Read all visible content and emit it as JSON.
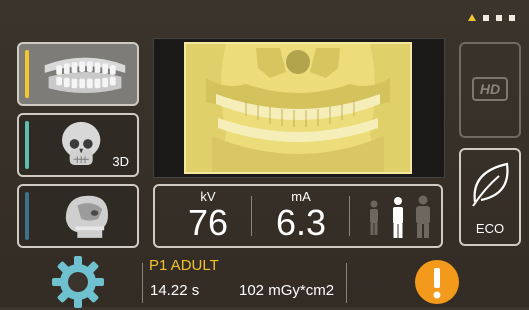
{
  "header": {
    "page_indicator": {
      "count": 4,
      "active_index": 0,
      "active_color": "#f2c532"
    }
  },
  "modes": [
    {
      "name": "panoramic",
      "selected": true,
      "accent": "#f2c532",
      "icon": "panoramic-teeth-icon"
    },
    {
      "name": "3d",
      "label": "3D",
      "selected": false,
      "accent": "#5bbfb0",
      "icon": "skull-3d-icon"
    },
    {
      "name": "cephalometric",
      "selected": false,
      "accent": "#3f6f8a",
      "icon": "ceph-head-icon"
    }
  ],
  "preview": {
    "image": "panoramic-xray-preview",
    "tint": "#ecdc7a"
  },
  "parameters": {
    "kv": {
      "unit": "kV",
      "value": "76"
    },
    "ma": {
      "unit": "mA",
      "value": "6.3"
    },
    "patient_size": {
      "options": [
        "small",
        "medium",
        "large"
      ],
      "selected": "medium"
    }
  },
  "side_buttons": {
    "hd": {
      "label": "HD",
      "enabled": false
    },
    "eco": {
      "label": "ECO",
      "enabled": true
    }
  },
  "info": {
    "patient": "P1 ADULT",
    "exposure_time": "14.22 s",
    "dose": "102 mGy*cm2"
  },
  "colors": {
    "accent_yellow": "#f2c12e",
    "warning_orange": "#f39a1c"
  },
  "icons": {
    "settings": "gear-icon",
    "warning": "warning-icon"
  }
}
